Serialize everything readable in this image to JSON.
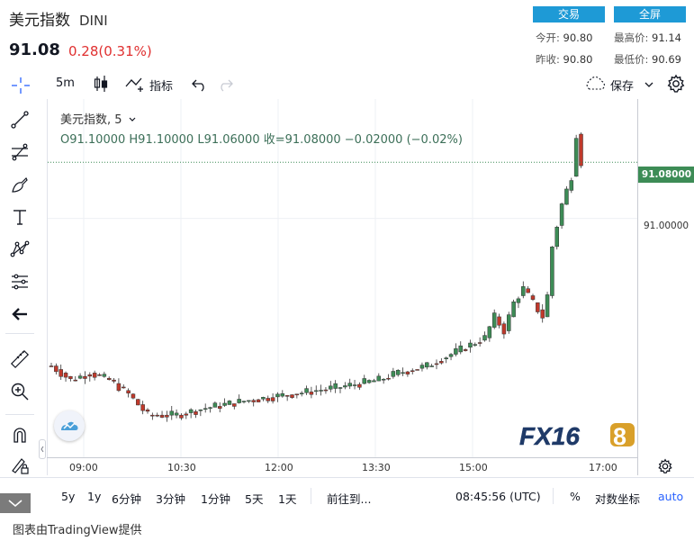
{
  "header": {
    "title": "美元指数",
    "symbol": "DINI",
    "price": "91.08",
    "change": "0.28(0.31%)",
    "trade_label": "交易",
    "fullscreen_label": "全屏",
    "stats": {
      "open_label": "今开:",
      "open_value": "90.80",
      "high_label": "最高价:",
      "high_value": "91.14",
      "prev_label": "昨收:",
      "prev_value": "90.80",
      "low_label": "最低价:",
      "low_value": "90.69"
    }
  },
  "toolbar": {
    "interval": "5m",
    "indicators_label": "指标",
    "save_label": "保存"
  },
  "legend": {
    "title": "美元指数, 5",
    "ohlc": "O91.10000   H91.10000   L91.06000   收=91.08000   −0.02000 (−0.02%)"
  },
  "price_axis": {
    "last_price_label": "91.08000",
    "tick_label": "91.00000"
  },
  "time_axis": [
    "09:00",
    "10:30",
    "12:00",
    "13:30",
    "15:00",
    "17:00"
  ],
  "watermark": "FX168",
  "bottom_bar": {
    "ranges": [
      "5y",
      "1y",
      "6分钟",
      "3分钟",
      "1分钟",
      "5天",
      "1天"
    ],
    "goto_label": "前往到...",
    "clock": "08:45:56 (UTC)",
    "percent_label": "%",
    "log_label": "对数坐标",
    "auto_label": "auto"
  },
  "footer": "图表由TradingView提供",
  "colors": {
    "up": "#3d8c56",
    "down": "#c0392b",
    "accent": "#1e9ad6",
    "change_red": "#e03030"
  },
  "chart_data": {
    "type": "candlestick",
    "title": "美元指数, 5",
    "x": [
      "09:00",
      "10:30",
      "12:00",
      "13:30",
      "15:00",
      "17:00"
    ],
    "ylim": [
      90.66,
      91.17
    ],
    "last": 91.08,
    "ohlc_sample": [
      {
        "o": 90.79,
        "h": 90.81,
        "l": 90.77,
        "c": 90.78
      },
      {
        "o": 90.73,
        "h": 90.74,
        "l": 90.7,
        "c": 90.71
      },
      {
        "o": 90.72,
        "h": 90.73,
        "l": 90.72,
        "c": 90.73
      },
      {
        "o": 90.76,
        "h": 90.78,
        "l": 90.75,
        "c": 90.77
      },
      {
        "o": 90.86,
        "h": 90.9,
        "l": 90.84,
        "c": 90.88
      },
      {
        "o": 91.02,
        "h": 91.07,
        "l": 90.99,
        "c": 91.04
      },
      {
        "o": 91.13,
        "h": 91.14,
        "l": 91.06,
        "c": 91.08
      }
    ]
  }
}
